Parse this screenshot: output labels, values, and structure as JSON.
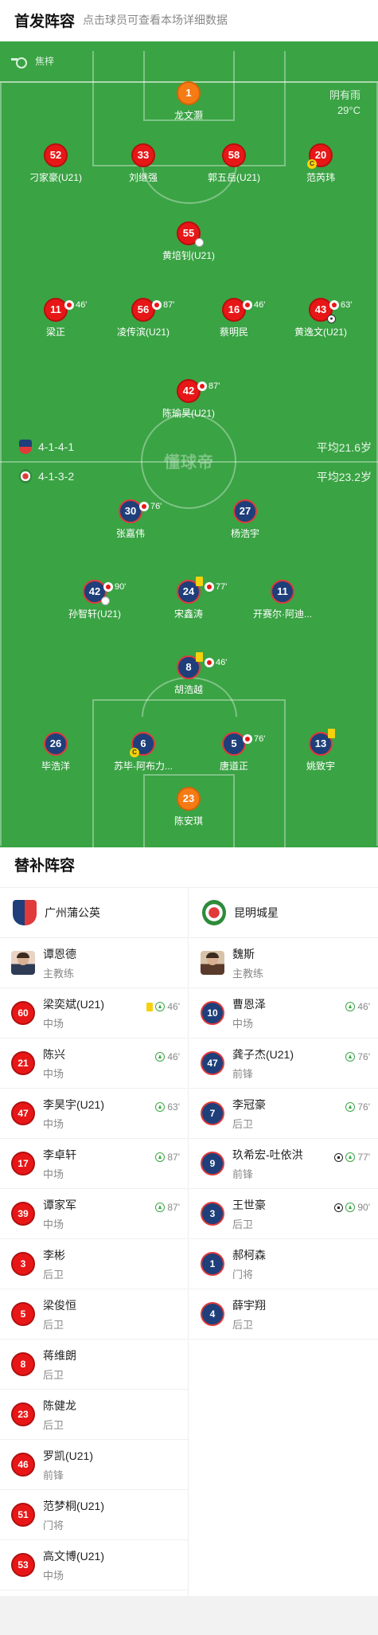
{
  "header": {
    "title": "首发阵容",
    "subtitle": "点击球员可查看本场详细数据"
  },
  "pitch": {
    "referee": "焦梓",
    "weather": "阴有雨",
    "temperature": "29°C",
    "watermark": "懂球帝",
    "home": {
      "formation": "4-1-4-1",
      "avg_age": "平均21.6岁"
    },
    "away": {
      "formation": "4-1-3-2",
      "avg_age": "平均23.2岁"
    },
    "players": [
      {
        "num": "1",
        "name": "龙文灏",
        "style": "gk"
      },
      {
        "num": "52",
        "name": "刁家豪(U21)",
        "style": "red"
      },
      {
        "num": "33",
        "name": "刘继强",
        "style": "red"
      },
      {
        "num": "58",
        "name": "郭五岳(U21)",
        "style": "red"
      },
      {
        "num": "20",
        "name": "范芮玮",
        "style": "red"
      },
      {
        "num": "55",
        "name": "黄培钊(U21)",
        "style": "red"
      },
      {
        "num": "11",
        "name": "梁正",
        "style": "red",
        "sub": "46'"
      },
      {
        "num": "56",
        "name": "凌传滨(U21)",
        "style": "red",
        "sub": "87'"
      },
      {
        "num": "16",
        "name": "蔡明民",
        "style": "red",
        "sub": "46'"
      },
      {
        "num": "43",
        "name": "黄逸文(U21)",
        "style": "red",
        "sub": "63'"
      },
      {
        "num": "42",
        "name": "陈瑜昊(U21)",
        "style": "red",
        "sub": "87'"
      },
      {
        "num": "30",
        "name": "张嘉伟",
        "style": "navy",
        "sub": "76'"
      },
      {
        "num": "27",
        "name": "杨浩宇",
        "style": "navy"
      },
      {
        "num": "42",
        "name": "孙智轩(U21)",
        "style": "navy",
        "sub": "90'"
      },
      {
        "num": "24",
        "name": "宋鑫涛",
        "style": "navy",
        "sub": "77'"
      },
      {
        "num": "11",
        "name": "开赛尔·阿迪...",
        "style": "navy"
      },
      {
        "num": "8",
        "name": "胡浩越",
        "style": "navy",
        "sub": "46'"
      },
      {
        "num": "26",
        "name": "毕浩洋",
        "style": "navy"
      },
      {
        "num": "6",
        "name": "苏毕-阿布力...",
        "style": "navy"
      },
      {
        "num": "5",
        "name": "唐道正",
        "style": "navy",
        "sub": "76'"
      },
      {
        "num": "13",
        "name": "姚致宇",
        "style": "navy"
      },
      {
        "num": "23",
        "name": "陈安琪",
        "style": "gk"
      }
    ]
  },
  "subs": {
    "title": "替补阵容",
    "home": {
      "team": "广州蒲公英",
      "coach": {
        "name": "谭恩德",
        "role": "主教练"
      },
      "players": [
        {
          "num": "60",
          "name": "梁奕斌(U21)",
          "pos": "中场",
          "time": "46'"
        },
        {
          "num": "21",
          "name": "陈兴",
          "pos": "中场",
          "time": "46'"
        },
        {
          "num": "47",
          "name": "李昊宇(U21)",
          "pos": "中场",
          "time": "63'"
        },
        {
          "num": "17",
          "name": "李卓轩",
          "pos": "中场",
          "time": "87'"
        },
        {
          "num": "39",
          "name": "谭家军",
          "pos": "中场",
          "time": "87'"
        },
        {
          "num": "3",
          "name": "李彬",
          "pos": "后卫"
        },
        {
          "num": "5",
          "name": "梁俊恒",
          "pos": "后卫"
        },
        {
          "num": "8",
          "name": "蒋维朗",
          "pos": "后卫"
        },
        {
          "num": "23",
          "name": "陈健龙",
          "pos": "后卫"
        },
        {
          "num": "46",
          "name": "罗凯(U21)",
          "pos": "前锋"
        },
        {
          "num": "51",
          "name": "范梦桐(U21)",
          "pos": "门将"
        },
        {
          "num": "53",
          "name": "高文博(U21)",
          "pos": "中场"
        }
      ]
    },
    "away": {
      "team": "昆明城星",
      "coach": {
        "name": "魏斯",
        "role": "主教练"
      },
      "players": [
        {
          "num": "10",
          "name": "曹恩泽",
          "pos": "中场",
          "time": "46'"
        },
        {
          "num": "47",
          "name": "龚子杰(U21)",
          "pos": "前锋",
          "time": "76'"
        },
        {
          "num": "7",
          "name": "李冠豪",
          "pos": "后卫",
          "time": "76'"
        },
        {
          "num": "9",
          "name": "玖希宏-吐依洪",
          "pos": "前锋",
          "time": "77'"
        },
        {
          "num": "3",
          "name": "王世豪",
          "pos": "后卫",
          "time": "90'"
        },
        {
          "num": "1",
          "name": "郝柯森",
          "pos": "门将"
        },
        {
          "num": "4",
          "name": "薛宇翔",
          "pos": "后卫"
        }
      ]
    }
  }
}
